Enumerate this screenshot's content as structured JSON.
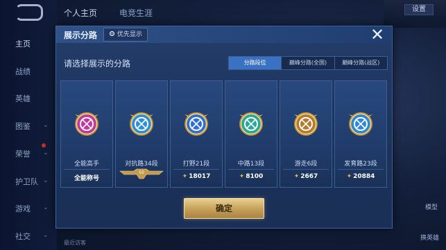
{
  "background": {
    "top_tabs": [
      "个人主页",
      "电竞生涯"
    ],
    "nav_items": [
      "主页",
      "战绩",
      "英雄",
      "图鉴",
      "荣誉",
      "护卫队",
      "游戏",
      "社交"
    ],
    "settings_label": "设置",
    "right_labels": [
      "模型",
      "换英雄"
    ],
    "bottom_text": "最近访客"
  },
  "dialog": {
    "title": "展示分路",
    "priority_label": "优先显示",
    "close_label": "✕",
    "prompt": "请选择展示的分路",
    "tabs": [
      {
        "label": "分路段位",
        "active": true
      },
      {
        "label": "巅峰分路(全国)",
        "active": false
      },
      {
        "label": "巅峰分路(战区)",
        "active": false
      }
    ],
    "cards": [
      {
        "name": "全能高手",
        "stat": "全能称号",
        "has_bolt": false,
        "icon": "all-round-emblem-icon",
        "color": "#c0389f"
      },
      {
        "name": "对抗路34段",
        "stat": "50",
        "has_bolt": false,
        "icon": "clash-lane-emblem-icon",
        "color": "#2f8fd6"
      },
      {
        "name": "打野21段",
        "stat": "18017",
        "has_bolt": true,
        "icon": "jungle-emblem-icon",
        "color": "#2f6fd0"
      },
      {
        "name": "中路13段",
        "stat": "8100",
        "has_bolt": true,
        "icon": "mid-lane-emblem-icon",
        "color": "#2aa79b"
      },
      {
        "name": "游走6段",
        "stat": "2667",
        "has_bolt": true,
        "icon": "roam-emblem-icon",
        "color": "#b57a2e"
      },
      {
        "name": "发育路23段",
        "stat": "20884",
        "has_bolt": true,
        "icon": "farm-lane-emblem-icon",
        "color": "#2f86d6"
      }
    ],
    "confirm_label": "确定"
  }
}
